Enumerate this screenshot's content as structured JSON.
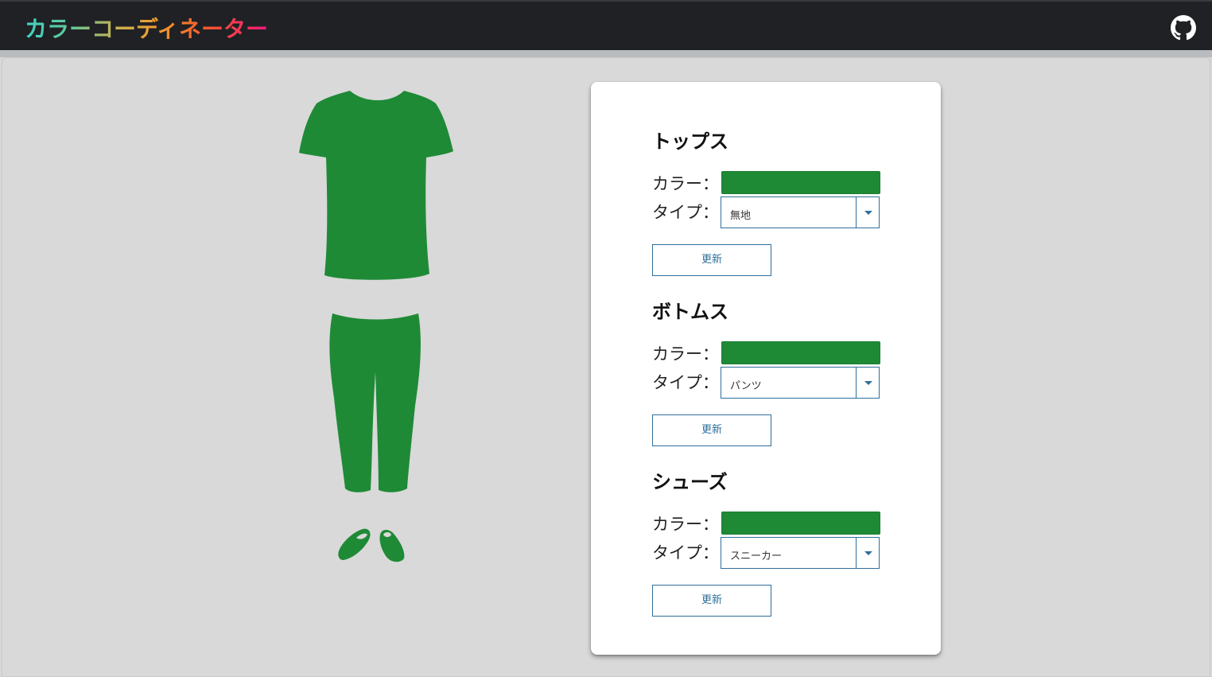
{
  "app": {
    "title": "カラーコーディネーター"
  },
  "header": {
    "github_icon": "github-icon"
  },
  "colors": {
    "garment": "#1f8a36",
    "navbar": "#202124",
    "accent": "#2e6f9a"
  },
  "sections": [
    {
      "title": "トップス",
      "color_label": "カラー：",
      "color_value": "#1f8a36",
      "type_label": "タイプ：",
      "type_value": "無地",
      "update_label": "更新"
    },
    {
      "title": "ボトムス",
      "color_label": "カラー：",
      "color_value": "#1f8a36",
      "type_label": "タイプ：",
      "type_value": "パンツ",
      "update_label": "更新"
    },
    {
      "title": "シューズ",
      "color_label": "カラー：",
      "color_value": "#1f8a36",
      "type_label": "タイプ：",
      "type_value": "スニーカー",
      "update_label": "更新"
    }
  ]
}
